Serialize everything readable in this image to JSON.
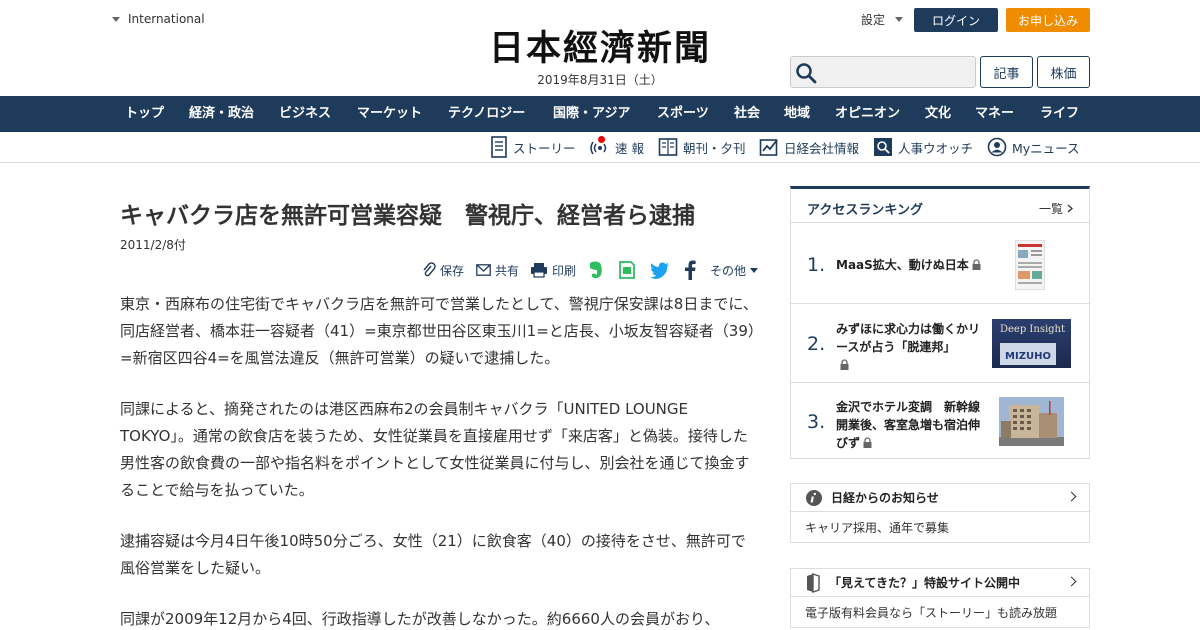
{
  "header": {
    "region": "International",
    "date": "2019年8月31日（土）",
    "settings": "設定",
    "login": "ログイン",
    "apply": "お申し込み",
    "search_placeholder": "",
    "btn_articles": "記事",
    "btn_stocks": "株価",
    "colors": {
      "navy": "#1f3b5c",
      "orange": "#f08c00"
    }
  },
  "nav": {
    "items": [
      "トップ",
      "経済・政治",
      "ビジネス",
      "マーケット",
      "テクノロジー",
      "国際・アジア",
      "スポーツ",
      "社会",
      "地域",
      "オピニオン",
      "文化",
      "マネー",
      "ライフ"
    ]
  },
  "subnav": {
    "items": [
      "ストーリー",
      "速 報",
      "朝刊・夕刊",
      "日経会社情報",
      "人事ウオッチ",
      "Myニュース"
    ]
  },
  "article": {
    "headline": "キャバクラ店を無許可営業容疑　警視庁、経営者ら逮捕",
    "date": "2011/2/8付",
    "share": {
      "save": "保存",
      "share": "共有",
      "print": "印刷",
      "more": "その他"
    },
    "paragraphs": [
      "東京・西麻布の住宅街でキャバクラ店を無許可で営業したとして、警視庁保安課は8日までに、同店経営者、橋本荘一容疑者（41）=東京都世田谷区東玉川1=と店長、小坂友智容疑者（39）=新宿区四谷4=を風営法違反（無許可営業）の疑いで逮捕した。",
      "同課によると、摘発されたのは港区西麻布2の会員制キャバクラ「UNITED LOUNGE TOKYO」。通常の飲食店を装うため、女性従業員を直接雇用せず「来店客」と偽装。接待した男性客の飲食費の一部や指名料をポイントとして女性従業員に付与し、別会社を通じて換金することで給与を払っていた。",
      "逮捕容疑は今月4日午後10時50分ごろ、女性（21）に飲食客（40）の接待をさせ、無許可で風俗営業をした疑い。",
      "同課が2009年12月から4回、行政指導したが改善しなかった。約6660人の会員がおり、"
    ]
  },
  "sidebar": {
    "ranking": {
      "title": "アクセスランキング",
      "more": "一覧",
      "items": [
        {
          "rank": "1.",
          "title": "MaaS拡大、動けぬ日本",
          "thumb": "document-thumbnail"
        },
        {
          "rank": "2.",
          "title": "みずほに求心力は働くかリースが占う「脱連邦」",
          "thumb": "mizuho-sign-thumbnail",
          "thumb_text": "Deep Insight"
        },
        {
          "rank": "3.",
          "title": "金沢でホテル変調　新幹線開業後、客室急増も宿泊伸びず",
          "thumb": "hotel-building-thumbnail"
        }
      ]
    },
    "notices": [
      {
        "title": "日経からのお知らせ",
        "body": "キャリア採用、通年で募集",
        "icon": "info-icon"
      },
      {
        "title": "「見えてきた？」特設サイト公開中",
        "body": "電子版有料会員なら「ストーリー」も読み放題",
        "icon": "book-icon"
      }
    ]
  }
}
